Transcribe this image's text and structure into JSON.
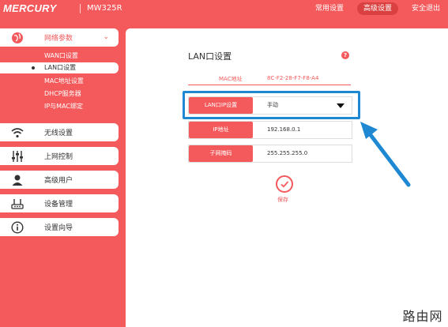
{
  "header": {
    "brand": "MERCURY",
    "model": "MW325R",
    "nav": [
      {
        "label": "常用设置",
        "active": false
      },
      {
        "label": "高级设置",
        "active": true
      },
      {
        "label": "安全退出",
        "active": false
      }
    ]
  },
  "sidebar": {
    "network": {
      "label": "网络参数",
      "submenu": [
        "WAN口设置",
        "LAN口设置",
        "MAC地址设置",
        "DHCP服务器",
        "IP与MAC绑定"
      ],
      "selected_index": 1
    },
    "items": [
      {
        "label": "无线设置",
        "icon": "wifi-icon"
      },
      {
        "label": "上网控制",
        "icon": "sliders-icon"
      },
      {
        "label": "高级用户",
        "icon": "user-icon"
      },
      {
        "label": "设备管理",
        "icon": "router-icon"
      },
      {
        "label": "设置向导",
        "icon": "info-icon"
      }
    ]
  },
  "main": {
    "title": "LAN口设置",
    "help_icon": "?",
    "mac": {
      "label": "MAC地址",
      "value": "8C-F2-28-F7-F8-A4"
    },
    "fields": [
      {
        "label": "LAN口IP设置",
        "value": "手动"
      },
      {
        "label": "IP地址",
        "value": "192.168.0.1"
      },
      {
        "label": "子网掩码",
        "value": "255.255.255.0"
      }
    ],
    "save_label": "保存"
  },
  "watermark": "路由网",
  "colors": {
    "accent": "#f4595b",
    "highlight": "#1e88d2"
  }
}
